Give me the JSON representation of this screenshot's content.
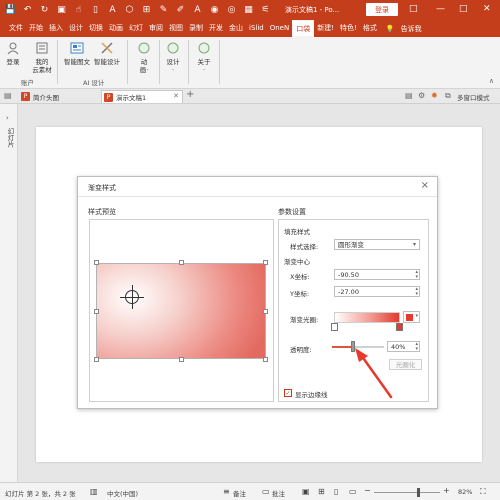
{
  "titlebar": {
    "title": "演示文稿1 - Po...",
    "login": "登录",
    "restore": "□",
    "minimize": "—",
    "close": "✕"
  },
  "ribbon_tabs": [
    "文件",
    "开始",
    "插入",
    "设计",
    "切换",
    "动画",
    "幻灯",
    "审阅",
    "视图",
    "录制",
    "开发",
    "金山",
    "iSlid",
    "OneN",
    "口袋",
    "新建!",
    "特色!",
    "格式"
  ],
  "ribbon_tabs_tell": "告诉我",
  "ribbon_active_tab": "口袋",
  "ribbon": {
    "account_group": "账户",
    "login": "登录",
    "my_material": "我的\n云素材",
    "smart_graphic": "智能图文",
    "smart_design": "智能设计",
    "ai_group": "AI 设计",
    "animation": "动\n画·",
    "design": "设计\n·",
    "about": "关于\n·"
  },
  "doctabs": {
    "tab1": "简介头图",
    "tab2": "演示文稿1",
    "multi_window": "多窗口模式"
  },
  "leftpane": {
    "label": "幻灯片"
  },
  "dialog": {
    "title": "渐变样式",
    "preview_label": "样式预览",
    "params_label": "参数设置",
    "fill_style": "填充样式",
    "style_select_label": "样式选择:",
    "style_select_value": "圆形渐变",
    "gradient_center": "渐变中心",
    "x_label": "X坐标:",
    "x_value": "-90.50",
    "y_label": "Y坐标:",
    "y_value": "-27.00",
    "aperture_label": "渐变光圈:",
    "transparency_label": "透明度:",
    "transparency_value": "40%",
    "transparency_fraction": 0.4,
    "smooth_button": "光圈化",
    "show_border": "显示边缘线",
    "gradient_color": "#e53a2d"
  },
  "statusbar": {
    "slide_info": "幻灯片 第 2 张，共 2 张",
    "language": "中文(中国)",
    "notes": "备注",
    "comments": "批注",
    "zoom": "82%"
  }
}
